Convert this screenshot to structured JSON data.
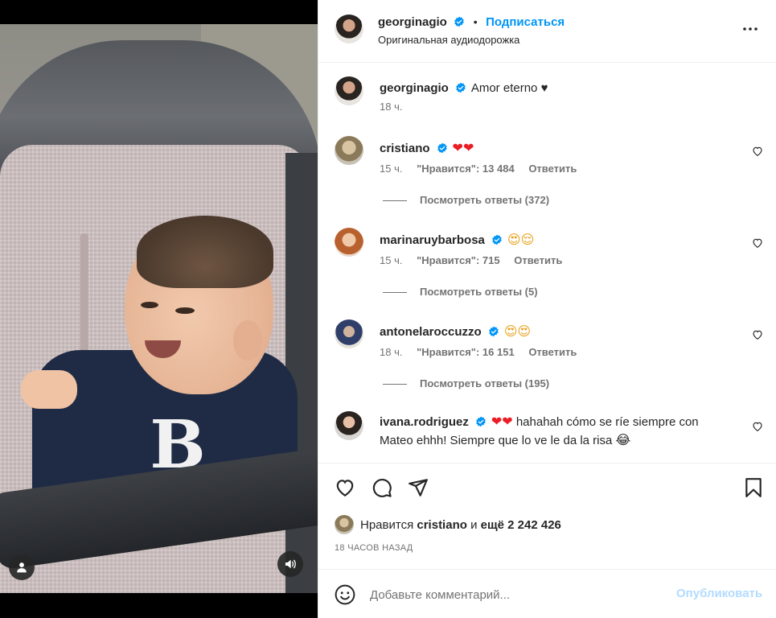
{
  "post": {
    "author": "georginagio",
    "follow_label": "Подписаться",
    "audio": "Оригинальная аудиодорожка",
    "caption": "Amor eterno",
    "caption_heart": "♥",
    "caption_time": "18 ч."
  },
  "comments": [
    {
      "username": "cristiano",
      "text": "",
      "emoji": "❤❤",
      "time": "15 ч.",
      "likes": "\"Нравится\": 13 484",
      "reply_label": "Ответить",
      "view_replies": "Посмотреть ответы (372)"
    },
    {
      "username": "marinaruybarbosa",
      "text": "",
      "emoji": "😍😌",
      "time": "15 ч.",
      "likes": "\"Нравится\": 715",
      "reply_label": "Ответить",
      "view_replies": "Посмотреть ответы (5)"
    },
    {
      "username": "antonelaroccuzzo",
      "text": "",
      "emoji": "😍😍",
      "time": "18 ч.",
      "likes": "\"Нравится\": 16 151",
      "reply_label": "Ответить",
      "view_replies": "Посмотреть ответы (195)"
    },
    {
      "username": "ivana.rodriguez",
      "emoji": "❤❤",
      "text": "hahahah cómo se ríe siempre con Mateo ehhh! Siempre que lo ve le da la risa",
      "emoji_end": "😂"
    }
  ],
  "likes_summary": {
    "prefix": "Нравится",
    "user": "cristiano",
    "middle": "и",
    "count": "ещё 2 242 426"
  },
  "time_ago": "18 ЧАСОВ НАЗАД",
  "comment_box": {
    "placeholder": "Добавьте комментарий...",
    "publish_label": "Опубликовать"
  },
  "colors": {
    "accent": "#0095f6",
    "verified": "#0095f6",
    "publish_disabled": "#b3dbff",
    "heart_red": "#ed1c24"
  },
  "icons": [
    "user-icon",
    "sound-icon",
    "more-icon",
    "heart-icon",
    "comment-icon",
    "share-icon",
    "bookmark-icon",
    "smile-icon",
    "verified-icon"
  ]
}
